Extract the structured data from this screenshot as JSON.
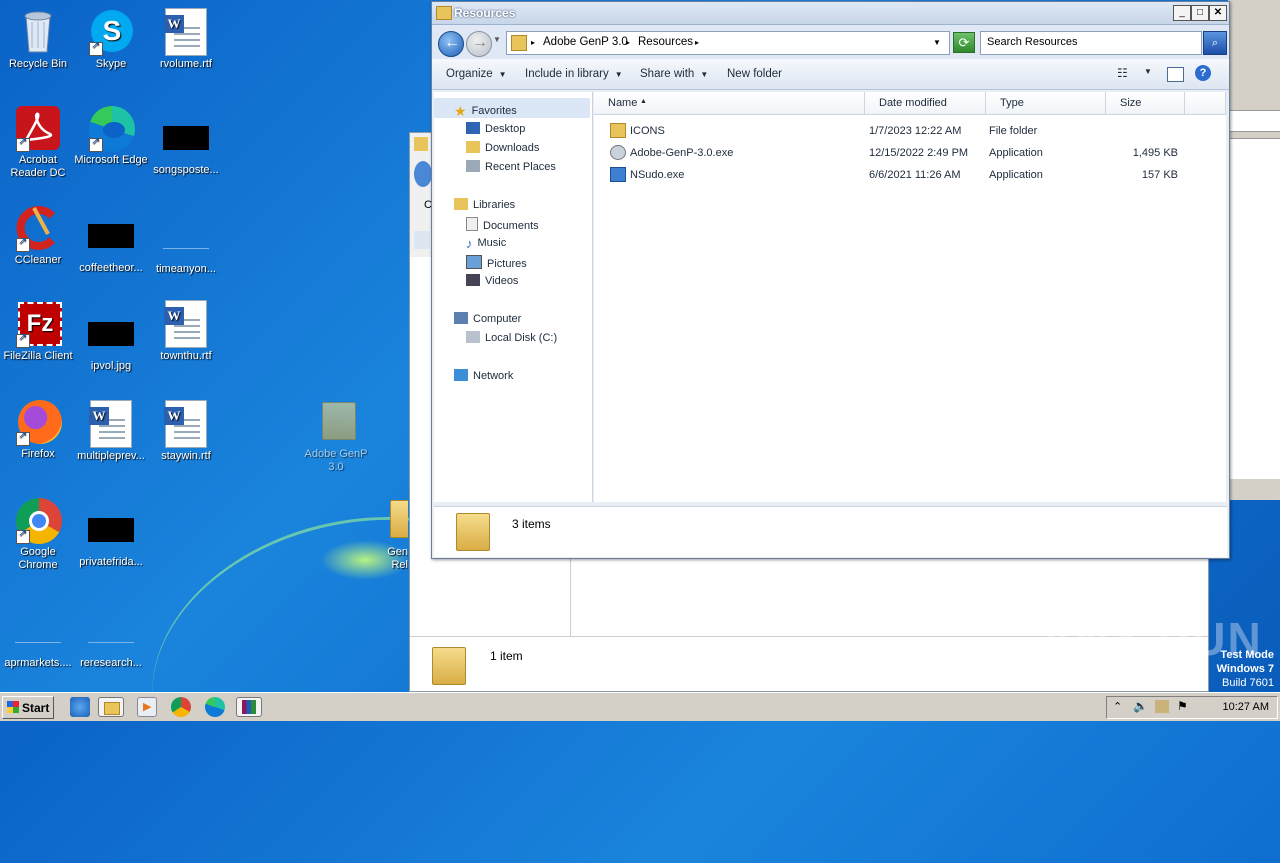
{
  "desktop": {
    "icons": [
      {
        "label": "Recycle Bin"
      },
      {
        "label": "Skype"
      },
      {
        "label": "rvolume.rtf"
      },
      {
        "label": "Acrobat Reader DC"
      },
      {
        "label": "Microsoft Edge"
      },
      {
        "label": "songsposte..."
      },
      {
        "label": "CCleaner"
      },
      {
        "label": "coffeetheor..."
      },
      {
        "label": "timeanyon..."
      },
      {
        "label": "FileZilla Client"
      },
      {
        "label": "ipvol.jpg"
      },
      {
        "label": "townthu.rtf"
      },
      {
        "label": "Firefox"
      },
      {
        "label": "multipleprev..."
      },
      {
        "label": "staywin.rtf"
      },
      {
        "label": "Adobe GenP 3.0"
      },
      {
        "label": "Google Chrome"
      },
      {
        "label": "privatefrida..."
      },
      {
        "label": "Gen Rel"
      },
      {
        "label": "aprmarkets...."
      },
      {
        "label": "reresearch..."
      }
    ]
  },
  "background_window": {
    "status_text": "1 item",
    "partial_label": "C"
  },
  "window": {
    "title": "Resources",
    "address": {
      "crumb1": "Adobe GenP 3.0",
      "crumb2": "Resources"
    },
    "search_placeholder": "Search Resources",
    "commands": {
      "organize": "Organize",
      "include": "Include in library",
      "share": "Share with",
      "new_folder": "New folder"
    },
    "nav": {
      "favorites": "Favorites",
      "desktop": "Desktop",
      "downloads": "Downloads",
      "recent": "Recent Places",
      "libraries": "Libraries",
      "documents": "Documents",
      "music": "Music",
      "pictures": "Pictures",
      "videos": "Videos",
      "computer": "Computer",
      "local_disk": "Local Disk (C:)",
      "network": "Network"
    },
    "columns": {
      "name": "Name",
      "date": "Date modified",
      "type": "Type",
      "size": "Size"
    },
    "files": [
      {
        "name": "ICONS",
        "date": "1/7/2023 12:22 AM",
        "type": "File folder",
        "size": ""
      },
      {
        "name": "Adobe-GenP-3.0.exe",
        "date": "12/15/2022 2:49 PM",
        "type": "Application",
        "size": "1,495 KB"
      },
      {
        "name": "NSudo.exe",
        "date": "6/6/2021 11:26 AM",
        "type": "Application",
        "size": "157 KB"
      }
    ],
    "status_text": "3 items"
  },
  "taskbar": {
    "start_label": "Start",
    "clock": "10:27 AM"
  },
  "overlay": {
    "watermark": "ANY RUN",
    "test_mode": "Test Mode",
    "os": "Windows 7",
    "build": "Build 7601"
  }
}
